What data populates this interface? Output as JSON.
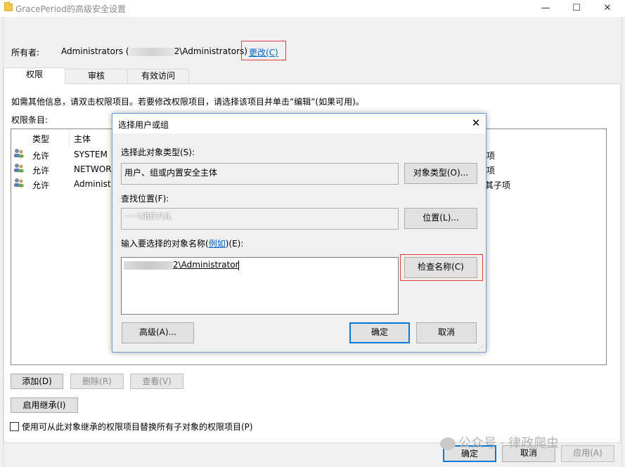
{
  "window": {
    "title": "GracePeriod的高级安全设置",
    "minimize_glyph": "—",
    "maximize_glyph": "☐",
    "close_glyph": "✕"
  },
  "owner": {
    "label": "所有者:",
    "value_prefix": "Administrators (",
    "value_suffix": "2\\Administrators)",
    "change_link": "更改(C)"
  },
  "tabs": [
    {
      "label": "权限",
      "active": true
    },
    {
      "label": "审核",
      "active": false
    },
    {
      "label": "有效访问",
      "active": false
    }
  ],
  "info_text": "如需其他信息，请双击权限项目。若要修改权限项目，请选择该项目并单击“编辑”(如果可用)。",
  "entries_label": "权限条目:",
  "columns": {
    "type": "类型",
    "principal": "主体"
  },
  "rows": [
    {
      "type": "允许",
      "principal": "SYSTEM",
      "right_fragment": "项"
    },
    {
      "type": "允许",
      "principal": "NETWOR",
      "right_fragment": "项"
    },
    {
      "type": "允许",
      "principal": "Administ",
      "right_fragment": "其子项"
    }
  ],
  "buttons": {
    "add": "添加(D)",
    "remove": "删除(R)",
    "view": "查看(V)",
    "enable_inheritance": "启用继承(I)",
    "ok": "确定",
    "cancel": "取消",
    "apply": "应用(A)"
  },
  "replace_checkbox_label": "使用可从此对象继承的权限项目替换所有子对象的权限项目(P)",
  "dialog": {
    "title": "选择用户或组",
    "close_glyph": "✕",
    "object_type_label": "选择此对象类型(S):",
    "object_type_value": "用户、组或内置安全主体",
    "object_type_button": "对象类型(O)...",
    "location_label": "查找位置(F):",
    "location_value": "·····UBEVUL",
    "location_button": "位置(L)...",
    "names_label_prefix": "输入要选择的对象名称(",
    "names_label_link": "例如",
    "names_label_suffix": ")(E):",
    "names_value_suffix": "2\\Administrator",
    "check_names_button": "检查名称(C)",
    "advanced_button": "高级(A)...",
    "ok_button": "确定",
    "cancel_button": "取消"
  },
  "watermark": "公众号 · 律政爬虫",
  "colors": {
    "link": "#0066cc",
    "highlight_box": "#e23b3b",
    "default_button_border": "#0078d7"
  }
}
